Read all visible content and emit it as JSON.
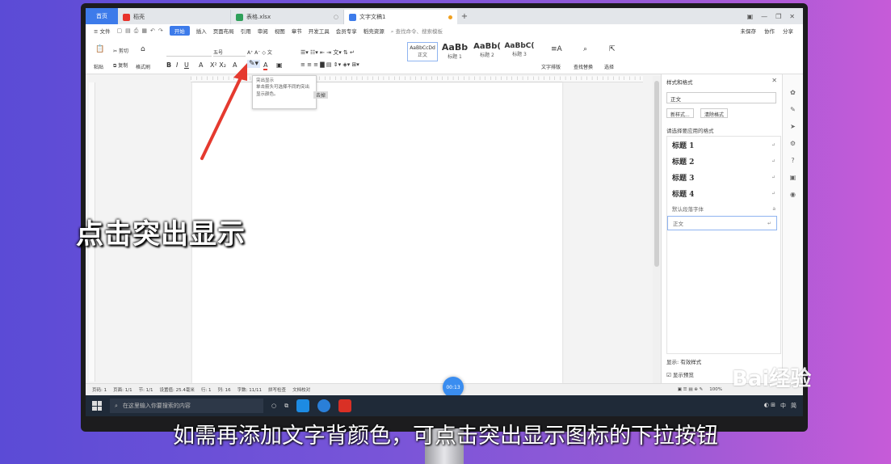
{
  "tabs": {
    "home": "首页",
    "daoke": "稻壳",
    "sheet": "表格.xlsx",
    "doc": "文字文稿1",
    "add": "+"
  },
  "menu": {
    "file": "文件",
    "start": "开始",
    "items": [
      "插入",
      "页面布局",
      "引用",
      "审阅",
      "视图",
      "章节",
      "开发工具",
      "会员专享",
      "稻壳资源"
    ],
    "search": "查找命令、搜索模板",
    "right": [
      "未保存",
      "协作",
      "分享"
    ]
  },
  "ribbon": {
    "cut": "剪切",
    "copy": "复制",
    "paste": "粘贴",
    "format_painter": "格式刷",
    "font_size": "五号",
    "styles": [
      {
        "sample": "AaBbCcDd",
        "name": "正文"
      },
      {
        "sample": "AaBb",
        "name": "标题 1"
      },
      {
        "sample": "AaBb(",
        "name": "标题 2"
      },
      {
        "sample": "AaBbC(",
        "name": "标题 3"
      }
    ],
    "text_layout": "文字排版",
    "find_replace": "查找替换",
    "select": "选择"
  },
  "tooltip": {
    "title": "突出显示",
    "desc": "单击箭头可选择不同的突出显示颜色。",
    "highlight_tag": "去掉"
  },
  "styles_panel": {
    "header": "样式和格式",
    "current": "正文",
    "new_style": "新样式...",
    "clear_format": "清除格式",
    "apply_label": "请选择要应用的格式",
    "items": [
      "标题 1",
      "标题 2",
      "标题 3",
      "标题 4"
    ],
    "default_font": "默认段落字体",
    "normal": "正文",
    "show_label": "显示:",
    "show_value": "有效样式",
    "preview": "显示预览"
  },
  "status": {
    "page": "页码: 1",
    "pages": "页面: 1/1",
    "section": "节: 1/1",
    "setting": "设置值: 25.4毫米",
    "row": "行: 1",
    "col": "列: 16",
    "words": "字数: 11/11",
    "spell": "拼写检查",
    "proof": "文档校对",
    "zoom": "100%"
  },
  "timer": "00:13",
  "taskbar": {
    "search": "在这里输入你要搜索的内容",
    "ime": "中",
    "ime2": "简"
  },
  "overlay_title": "点击突出显示",
  "subtitle": "如需再添加文字背颜色，可点击突出显示图标的下拉按钮",
  "watermark": "Bai经验",
  "colors": {
    "accent": "#3d7bea",
    "arrow": "#e53a2f"
  }
}
